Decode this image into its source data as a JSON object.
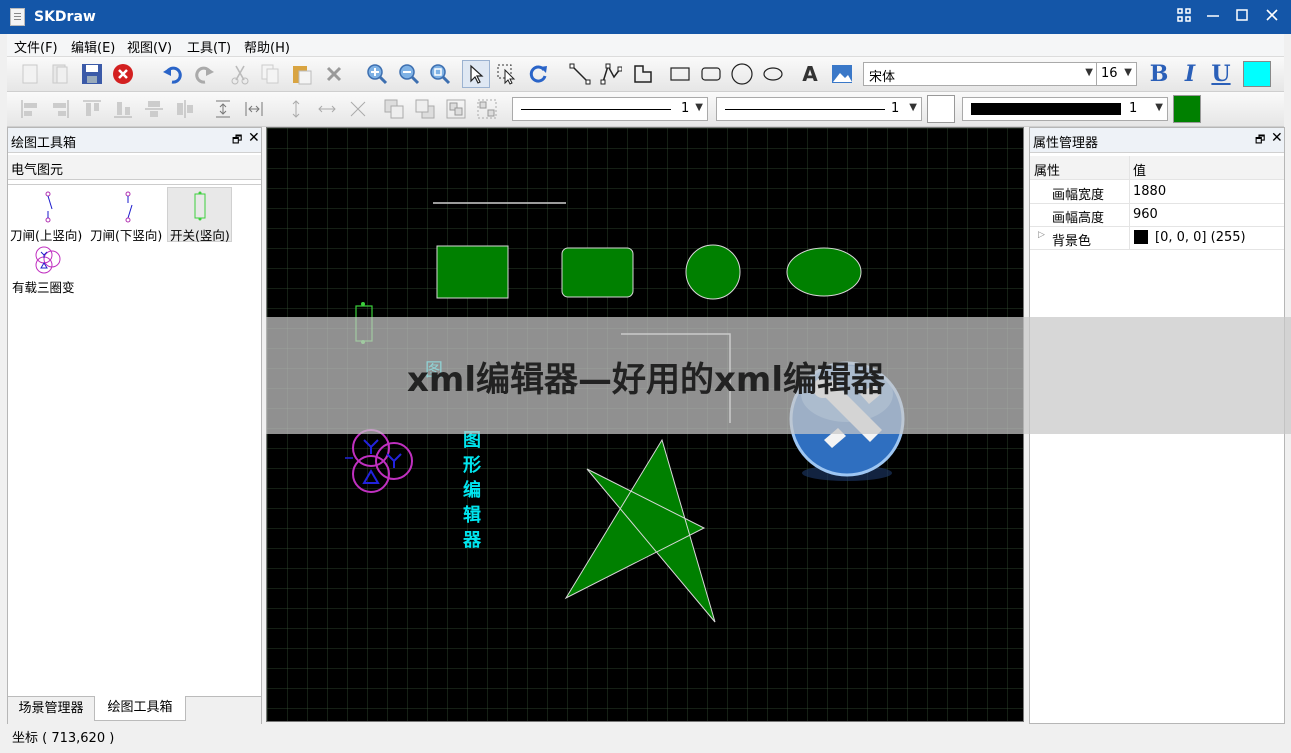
{
  "window": {
    "title": "SKDraw"
  },
  "menu": [
    "文件(F)",
    "编辑(E)",
    "视图(V)",
    "工具(T)",
    "帮助(H)"
  ],
  "toolbar": {
    "font_name": "宋体",
    "font_size": "16",
    "bold": "B",
    "italic": "I",
    "underline": "U",
    "fill_color": "#00ffff",
    "line1_width": "1",
    "line2_width": "1",
    "line3_width": "1",
    "line3_color": "#000000",
    "color_box1": "#ffffff",
    "color_box2": "#008000",
    "text_tool": "A"
  },
  "left_panel": {
    "title": "绘图工具箱",
    "category": "电气图元",
    "items": [
      "刀闸(上竖向)",
      "刀闸(下竖向)",
      "开关(竖向)",
      "有载三圈变"
    ],
    "tabs": [
      "场景管理器",
      "绘图工具箱"
    ]
  },
  "right_panel": {
    "title": "属性管理器",
    "col_prop": "属性",
    "col_value": "值",
    "rows": [
      {
        "key": "画幅宽度",
        "value": "1880"
      },
      {
        "key": "画幅高度",
        "value": "960"
      },
      {
        "key": "背景色",
        "value": "[0, 0, 0] (255)",
        "swatch": "#000000"
      }
    ]
  },
  "canvas": {
    "vertical_text": [
      "图",
      "形",
      "编",
      "辑",
      "器"
    ],
    "partial_text": "图",
    "shape_fill": "#008000",
    "text_color": "#00e5ee"
  },
  "status": {
    "coordinates": "坐标 ( 713,620 )"
  },
  "overlay": {
    "caption": "xml编辑器—好用的xml编辑器"
  }
}
